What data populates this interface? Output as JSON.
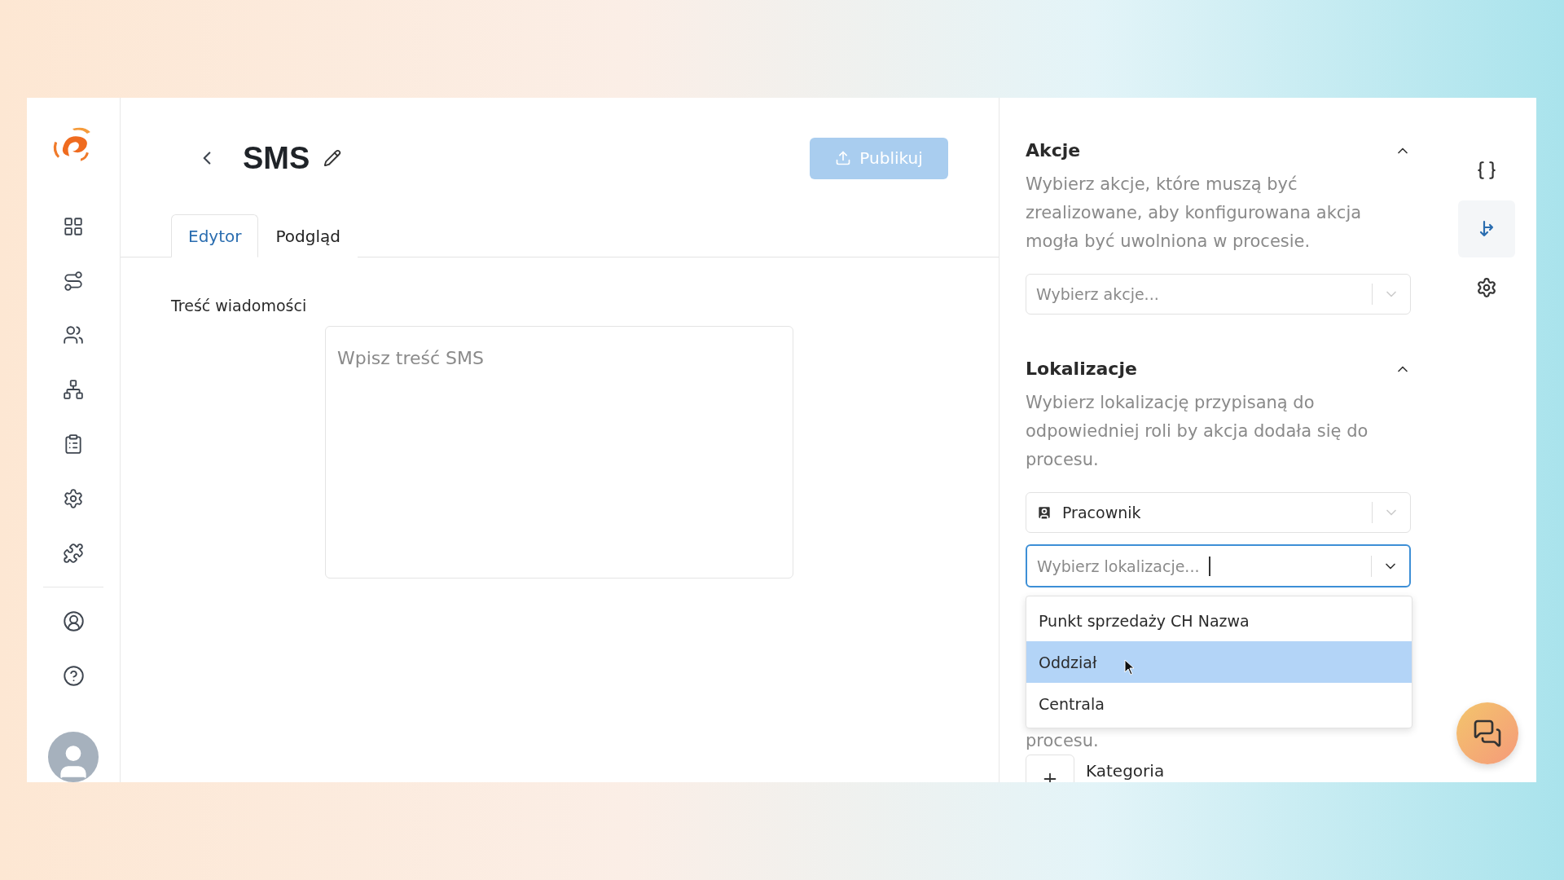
{
  "header": {
    "title": "SMS",
    "publish_button": {
      "label": "Publikuj",
      "disabled": true
    }
  },
  "tabs": [
    {
      "label": "Edytor",
      "selected": true
    },
    {
      "label": "Podgląd",
      "selected": false
    }
  ],
  "message": {
    "label": "Treść wiadomości",
    "placeholder": "Wpisz treść SMS"
  },
  "sections": [
    {
      "title": "Akcje",
      "expanded": true,
      "description": "Wybierz akcje, które muszą być zrealizowane, aby konfigurowana akcja mogła być uwolniona w procesie.",
      "selects": [
        {
          "kind": "plain",
          "placeholder": "Wybierz akcje...",
          "focused": false
        }
      ]
    },
    {
      "title": "Lokalizacje",
      "expanded": true,
      "description": "Wybierz lokalizację przypisaną do odpowiedniej roli by akcja dodała się do procesu.",
      "selects": [
        {
          "kind": "role",
          "value": "Pracownik",
          "focused": false
        },
        {
          "kind": "plain",
          "placeholder": "Wybierz lokalizacje...",
          "focused": true,
          "options": [
            {
              "label": "Punkt sprzedaży CH Nazwa",
              "selected": false
            },
            {
              "label": "Oddział",
              "selected": true
            },
            {
              "label": "Centrala",
              "selected": false
            }
          ]
        }
      ]
    }
  ],
  "next_section": {
    "description_tail": "procesu.",
    "add_button": "Kategoria"
  },
  "rail": [
    {
      "selected": false
    },
    {
      "selected": true
    },
    {
      "selected": false
    }
  ]
}
